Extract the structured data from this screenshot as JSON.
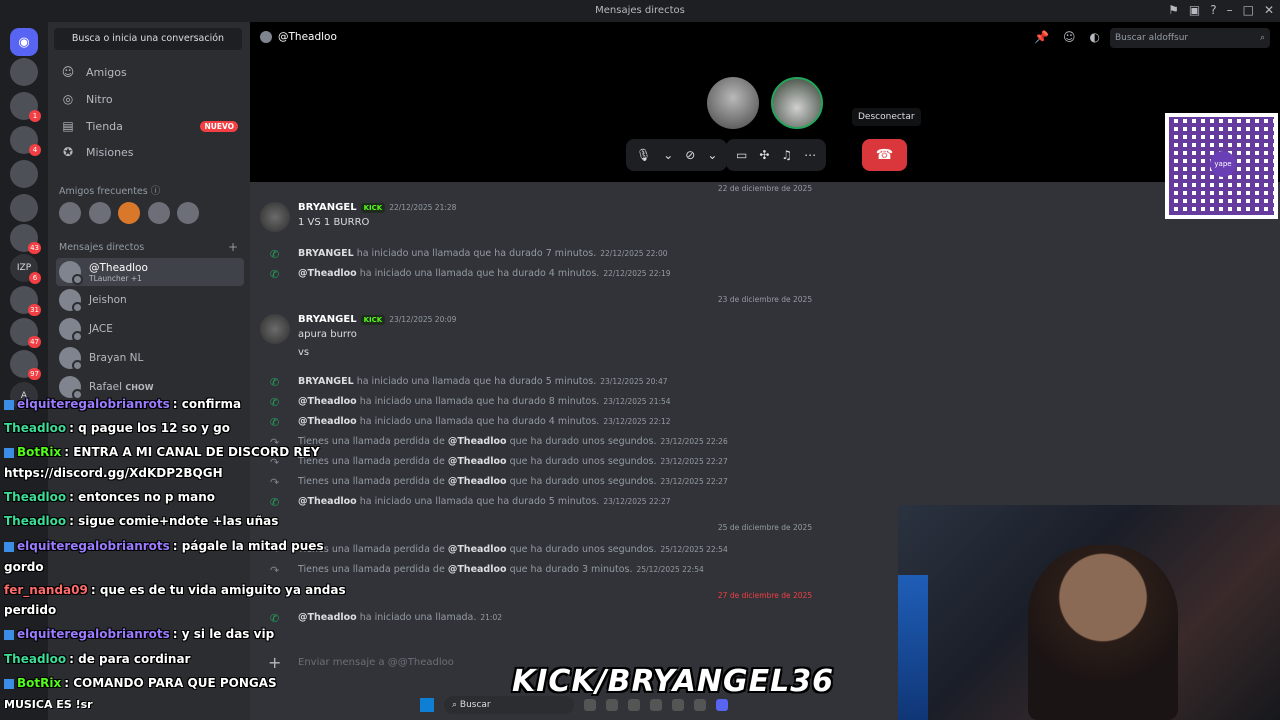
{
  "window": {
    "title": "Mensajes directos"
  },
  "sidebar": {
    "search_label": "Busca o inicia una conversación",
    "nav": [
      {
        "label": "Amigos",
        "icon": "friends-icon"
      },
      {
        "label": "Nitro",
        "icon": "nitro-icon"
      },
      {
        "label": "Tienda",
        "icon": "shop-icon",
        "badge": "NUEVO"
      },
      {
        "label": "Misiones",
        "icon": "quests-icon"
      }
    ],
    "frequent_label": "Amigos frecuentes",
    "dm_header": "Mensajes directos",
    "dms": [
      {
        "name": "@Theadloo",
        "sub": "TLauncher +1"
      },
      {
        "name": "Jeishon"
      },
      {
        "name": "JACE"
      },
      {
        "name": "Brayan NL"
      },
      {
        "name": "Rafael",
        "tag": "CHOW"
      }
    ]
  },
  "guild_badges": [
    "1",
    "4",
    "43",
    "6",
    "31",
    "47",
    "97"
  ],
  "guild_labels": {
    "izp": "IZP",
    "a": "A"
  },
  "header": {
    "channel": "@Theadloo",
    "search_placeholder": "Buscar aldoffsur"
  },
  "call": {
    "tooltip": "Desconectar"
  },
  "messages": {
    "date1": "22 de diciembre de 2025",
    "date2": "23 de diciembre de 2025",
    "date3": "25 de diciembre de 2025",
    "date4": "27 de diciembre de 2025",
    "m1": {
      "author": "BRYANGEL",
      "badge": "KICK",
      "time": "22/12/2025 21:28",
      "text": "1 VS 1 BURRO"
    },
    "c1": {
      "who": "BRYANGEL",
      "text": "ha iniciado una llamada que ha durado 7 minutos.",
      "time": "22/12/2025 22:00"
    },
    "c2": {
      "who": "@Theadloo",
      "text": "ha iniciado una llamada que ha durado 4 minutos.",
      "time": "22/12/2025 22:19"
    },
    "m2": {
      "author": "BRYANGEL",
      "badge": "KICK",
      "time": "23/12/2025 20:09",
      "line1": "apura burro",
      "line2": "vs"
    },
    "c3": {
      "who": "BRYANGEL",
      "text": "ha iniciado una llamada que ha durado 5 minutos.",
      "time": "23/12/2025 20:47"
    },
    "c4": {
      "who": "@Theadloo",
      "text": "ha iniciado una llamada que ha durado 8 minutos.",
      "time": "23/12/2025 21:54"
    },
    "c5": {
      "who": "@Theadloo",
      "text": "ha iniciado una llamada que ha durado 4 minutos.",
      "time": "23/12/2025 22:12"
    },
    "missed_prefix": "Tienes una llamada perdida de",
    "missed_who": "@Theadloo",
    "k1": {
      "text": "que ha durado unos segundos.",
      "time": "23/12/2025 22:26"
    },
    "k2": {
      "text": "que ha durado unos segundos.",
      "time": "23/12/2025 22:27"
    },
    "k3": {
      "text": "que ha durado unos segundos.",
      "time": "23/12/2025 22:27"
    },
    "c6": {
      "who": "@Theadloo",
      "text": "ha iniciado una llamada que ha durado 5 minutos.",
      "time": "23/12/2025 22:27"
    },
    "k4": {
      "text": "que ha durado unos segundos.",
      "time": "25/12/2025 22:54"
    },
    "k5": {
      "text": "que ha durado 3 minutos.",
      "time": "25/12/2025 22:54"
    },
    "c7": {
      "who": "@Theadloo",
      "text": "ha iniciado una llamada.",
      "time": "21:02"
    },
    "composer_placeholder": "Enviar mensaje a @@Theadloo"
  },
  "stream_chat": [
    {
      "user": "elquiteregalobrianrots",
      "text": ": confirma",
      "color": "#9b7bff"
    },
    {
      "user": "Theadloo",
      "text": ": q pague los 12 so y go",
      "color": "#3ddc97"
    },
    {
      "user": "BotRix",
      "text": ": ENTRA A MI CANAL DE DISCORD REY",
      "color": "#53fc18"
    },
    {
      "user": "",
      "text": "https://discord.gg/XdKDP2BQGH",
      "color": "#ffffff"
    },
    {
      "user": "Theadloo",
      "text": ": entonces no p mano",
      "color": "#3ddc97"
    },
    {
      "user": "Theadloo",
      "text": ": sigue comie+ndote +las uñas",
      "color": "#3ddc97"
    },
    {
      "user": "elquiteregalobrianrots",
      "text": ": págale la mitad pues",
      "color": "#9b7bff"
    },
    {
      "user": "",
      "text": "gordo",
      "color": "#ffffff"
    },
    {
      "user": "fer_nanda09",
      "text": ": que es de tu vida amiguito ya andas",
      "color": "#ff6b6b"
    },
    {
      "user": "",
      "text": "perdido",
      "color": "#ffffff"
    },
    {
      "user": "elquiteregalobrianrots",
      "text": ": y si le das vip",
      "color": "#9b7bff"
    },
    {
      "user": "Theadloo",
      "text": ": de para cordinar",
      "color": "#3ddc97"
    },
    {
      "user": "BotRix",
      "text": ": COMANDO PARA QUE PONGAS",
      "color": "#53fc18"
    }
  ],
  "overlay": {
    "banner": "KICK/BRYANGEL36",
    "music": "MUSICA ES !sr",
    "qr_logo": "yape"
  },
  "taskbar": {
    "search": "Buscar"
  },
  "colors": {
    "accent": "#5865f2",
    "hangup": "#da373c",
    "online": "#23a55a",
    "kick": "#53fc18"
  }
}
